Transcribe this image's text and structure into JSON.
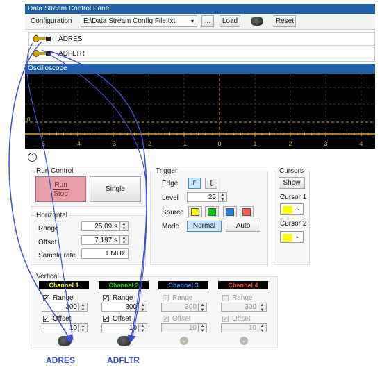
{
  "window": {
    "title": "Data Stream Control Panel"
  },
  "config": {
    "label": "Configuration",
    "file": "E:\\Data Stream Config File.txt",
    "browse": "...",
    "load": "Load",
    "reset": "Reset"
  },
  "streams": [
    {
      "label": "ADRES"
    },
    {
      "label": "ADFLTR"
    }
  ],
  "scope": {
    "title": "Oscilloscope",
    "y_label": "0",
    "x_ticks": [
      "-5",
      "-4",
      "-3",
      "-2",
      "-1",
      "0",
      "1",
      "2",
      "3",
      "4"
    ]
  },
  "run_control": {
    "title": "Run Control",
    "run": "Run",
    "stop": "Stop",
    "single": "Single"
  },
  "horizontal": {
    "title": "Horizontal",
    "range_label": "Range",
    "range_value": "25.09 s",
    "offset_label": "Offset",
    "offset_value": "7.197 s",
    "sample_label": "Sample rate",
    "sample_value": "1 MHz"
  },
  "trigger": {
    "title": "Trigger",
    "edge_label": "Edge",
    "edge_rise": "ꜰ",
    "edge_fall": "ʈ",
    "level_label": "Level",
    "level_value": "25",
    "source_label": "Source",
    "sources": [
      "#ffff00",
      "#00cc00",
      "#1e7fe6",
      "#ff5a4a"
    ],
    "mode_label": "Mode",
    "mode_normal": "Normal",
    "mode_auto": "Auto"
  },
  "cursors": {
    "title": "Cursors",
    "show": "Show",
    "c1_label": "Cursor 1",
    "c2_label": "Cursor 2",
    "c1_color": "#ffff00",
    "c2_color": "#ffff00"
  },
  "vertical": {
    "title": "Vertical",
    "channels": [
      {
        "name": "Channel 1",
        "color": "#ffff00",
        "range_label": "Range",
        "range": "300",
        "offset_label": "Offset",
        "offset": "10",
        "enabled": true
      },
      {
        "name": "Channel 2",
        "color": "#00e000",
        "range_label": "Range",
        "range": "300",
        "offset_label": "Offset",
        "offset": "10",
        "enabled": true
      },
      {
        "name": "Channel 3",
        "color": "#3a8cff",
        "range_label": "Range",
        "range": "300",
        "offset_label": "Offset",
        "offset": "10",
        "enabled": false
      },
      {
        "name": "Channel 4",
        "color": "#ff3b30",
        "range_label": "Range",
        "range": "300",
        "offset_label": "Offset",
        "offset": "10",
        "enabled": false
      }
    ]
  },
  "annotations": {
    "left": "ADRES",
    "right": "ADFLTR",
    "color": "#3b4fd6"
  }
}
